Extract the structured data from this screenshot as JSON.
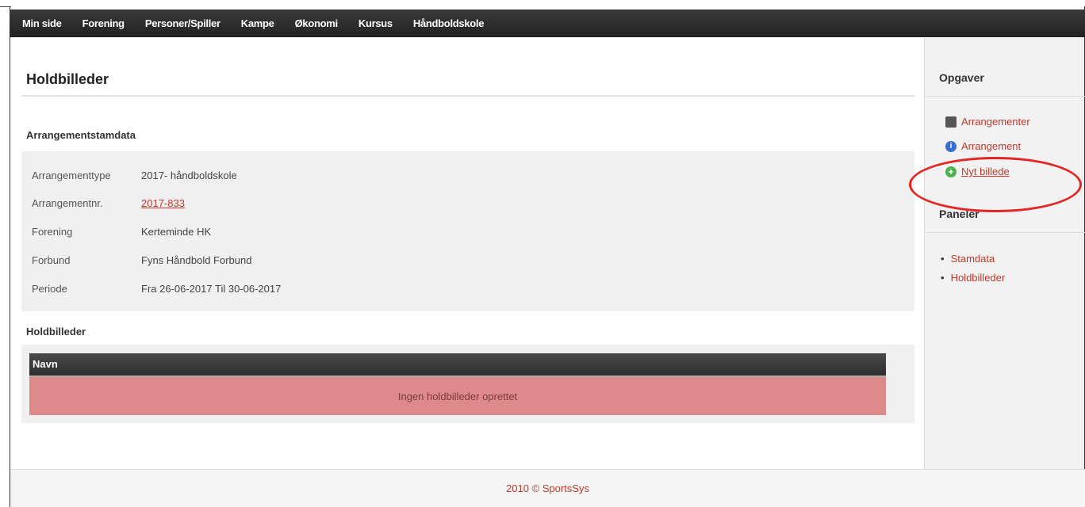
{
  "nav": {
    "items": [
      "Min side",
      "Forening",
      "Personer/Spiller",
      "Kampe",
      "Økonomi",
      "Kursus",
      "Håndboldskole"
    ]
  },
  "main": {
    "title": "Holdbilleder",
    "section1": "Arrangementstamdata",
    "info": [
      {
        "label": "Arrangementtype",
        "value": "2017- håndboldskole"
      },
      {
        "label": "Arrangementnr.",
        "value": "2017-833"
      },
      {
        "label": "Forening",
        "value": "Kerteminde HK"
      },
      {
        "label": "Forbund",
        "value": "Fyns Håndbold Forbund"
      },
      {
        "label": "Periode",
        "value": "Fra 26-06-2017 Til 30-06-2017"
      }
    ],
    "section2": "Holdbilleder",
    "table": {
      "header": "Navn",
      "empty_text": "Ingen holdbilleder oprettet"
    }
  },
  "sidebar": {
    "tasks_title": "Opgaver",
    "tasks": [
      {
        "label": "Arrangementer",
        "icon": "calendar-icon"
      },
      {
        "label": "Arrangement",
        "icon": "info-icon"
      },
      {
        "label": "Nyt billede",
        "icon": "add-icon"
      }
    ],
    "panels_title": "Paneler",
    "panels": [
      "Stamdata",
      "Holdbilleder"
    ]
  },
  "footer": {
    "text": "2010 © SportsSys"
  },
  "colors": {
    "link": "#c0392b",
    "navbar": "#2b2b2b",
    "empty_row": "#de8a8a",
    "highlight": "#e32626"
  }
}
